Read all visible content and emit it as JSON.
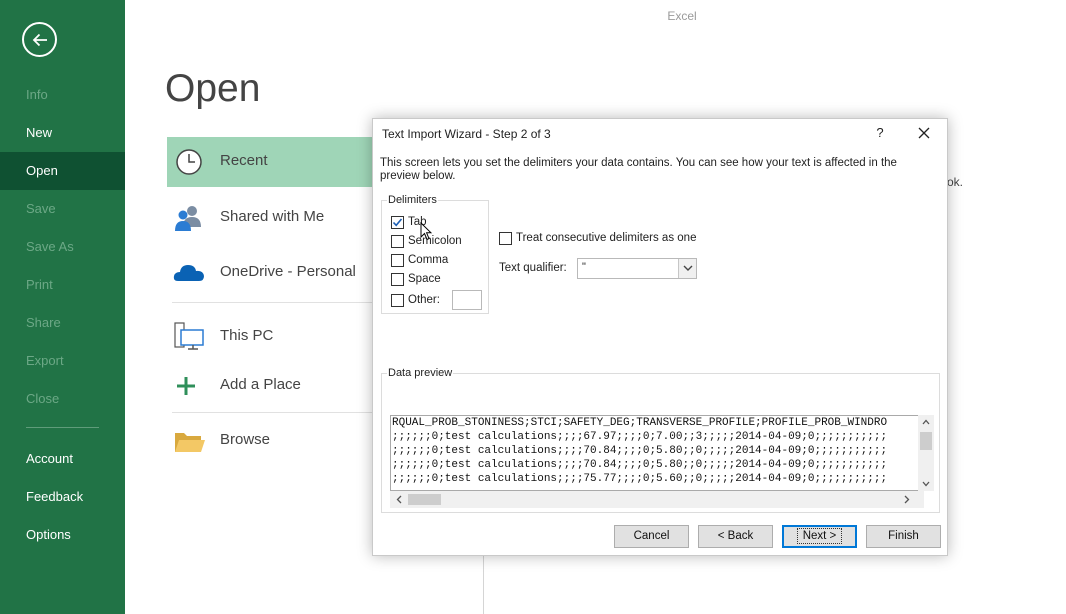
{
  "app": {
    "title": "Excel"
  },
  "sidebar": {
    "items": [
      {
        "label": "Info",
        "state": "disabled"
      },
      {
        "label": "New",
        "state": "enabled"
      },
      {
        "label": "Open",
        "state": "active"
      },
      {
        "label": "Save",
        "state": "disabled"
      },
      {
        "label": "Save As",
        "state": "disabled"
      },
      {
        "label": "Print",
        "state": "disabled"
      },
      {
        "label": "Share",
        "state": "disabled"
      },
      {
        "label": "Export",
        "state": "disabled"
      },
      {
        "label": "Close",
        "state": "disabled"
      },
      {
        "label": "Account",
        "state": "enabled"
      },
      {
        "label": "Feedback",
        "state": "enabled"
      },
      {
        "label": "Options",
        "state": "enabled"
      }
    ],
    "colors": {
      "background": "#217346",
      "active": "#0f5132",
      "disabled_text": "#6ca886"
    }
  },
  "open_page": {
    "title": "Open",
    "locations": [
      {
        "label": "Recent",
        "icon": "clock-icon",
        "selected": true
      },
      {
        "label": "Shared with Me",
        "icon": "people-icon",
        "selected": false
      },
      {
        "label": "OneDrive - Personal",
        "icon": "cloud-icon",
        "selected": false
      },
      {
        "label": "This PC",
        "icon": "computer-icon",
        "selected": false
      },
      {
        "label": "Add a Place",
        "icon": "plus-icon",
        "selected": false
      },
      {
        "label": "Browse",
        "icon": "folder-icon",
        "selected": false
      }
    ],
    "peek_text": "ok."
  },
  "dialog": {
    "title": "Text Import Wizard - Step 2 of 3",
    "help_label": "?",
    "description": "This screen lets you set the delimiters your data contains.  You can see how your text is affected in the preview below.",
    "delimiters": {
      "legend": "Delimiters",
      "options": [
        {
          "label": "Tab",
          "checked": true
        },
        {
          "label": "Semicolon",
          "checked": false
        },
        {
          "label": "Comma",
          "checked": false
        },
        {
          "label": "Space",
          "checked": false
        },
        {
          "label": "Other:",
          "checked": false
        }
      ],
      "other_value": ""
    },
    "consecutive": {
      "label": "Treat consecutive delimiters as one",
      "checked": false
    },
    "text_qualifier": {
      "label": "Text qualifier:",
      "value": "\""
    },
    "preview": {
      "legend": "Data preview",
      "lines": [
        "RQUAL_PROB_STONINESS;STCI;SAFETY_DEG;TRANSVERSE_PROFILE;PROFILE_PROB_WINDRO",
        ";;;;;;0;test calculations;;;;67.97;;;;0;7.00;;3;;;;;2014-04-09;0;;;;;;;;;;;",
        ";;;;;;0;test calculations;;;;70.84;;;;0;5.80;;0;;;;;2014-04-09;0;;;;;;;;;;;",
        ";;;;;;0;test calculations;;;;70.84;;;;0;5.80;;0;;;;;2014-04-09;0;;;;;;;;;;;",
        ";;;;;;0;test calculations;;;;75.77;;;;0;5.60;;0;;;;;2014-04-09;0;;;;;;;;;;;"
      ]
    },
    "buttons": {
      "cancel": "Cancel",
      "back": "< Back",
      "next": "Next >",
      "finish": "Finish"
    }
  }
}
